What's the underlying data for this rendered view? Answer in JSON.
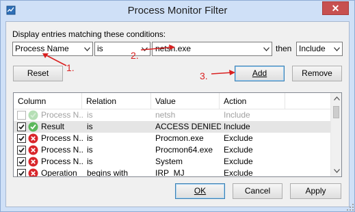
{
  "window": {
    "title": "Process Monitor Filter",
    "close_label": "✕"
  },
  "conditions_label": "Display entries matching these conditions:",
  "condition": {
    "column": "Process Name",
    "relation": "is",
    "value": "netsh.exe",
    "then_label": "then",
    "action": "Include"
  },
  "buttons": {
    "reset": "Reset",
    "add": "Add",
    "remove": "Remove",
    "ok": "OK",
    "cancel": "Cancel",
    "apply": "Apply"
  },
  "annotations": {
    "one": "1.",
    "two": "2.",
    "three": "3.",
    "color": "#d92020"
  },
  "list": {
    "headers": [
      "Column",
      "Relation",
      "Value",
      "Action"
    ],
    "rows": [
      {
        "column": "Process N...",
        "relation": "is",
        "value": "netsh",
        "action": "Include",
        "checked": false,
        "status": "include-icon",
        "selected": false,
        "disabled": true
      },
      {
        "column": "Result",
        "relation": "is",
        "value": "ACCESS DENIED",
        "action": "Include",
        "checked": true,
        "status": "include-icon",
        "selected": true,
        "disabled": false
      },
      {
        "column": "Process N...",
        "relation": "is",
        "value": "Procmon.exe",
        "action": "Exclude",
        "checked": true,
        "status": "exclude-icon",
        "selected": false,
        "disabled": false
      },
      {
        "column": "Process N...",
        "relation": "is",
        "value": "Procmon64.exe",
        "action": "Exclude",
        "checked": true,
        "status": "exclude-icon",
        "selected": false,
        "disabled": false
      },
      {
        "column": "Process N...",
        "relation": "is",
        "value": "System",
        "action": "Exclude",
        "checked": true,
        "status": "exclude-icon",
        "selected": false,
        "disabled": false
      },
      {
        "column": "Operation",
        "relation": "begins with",
        "value": "IRP_MJ_",
        "action": "Exclude",
        "checked": true,
        "status": "exclude-icon",
        "selected": false,
        "disabled": false
      }
    ]
  },
  "colors": {
    "include_green": "#5cb85c",
    "exclude_red": "#d9262b",
    "chrome": "#cfe0f7"
  }
}
